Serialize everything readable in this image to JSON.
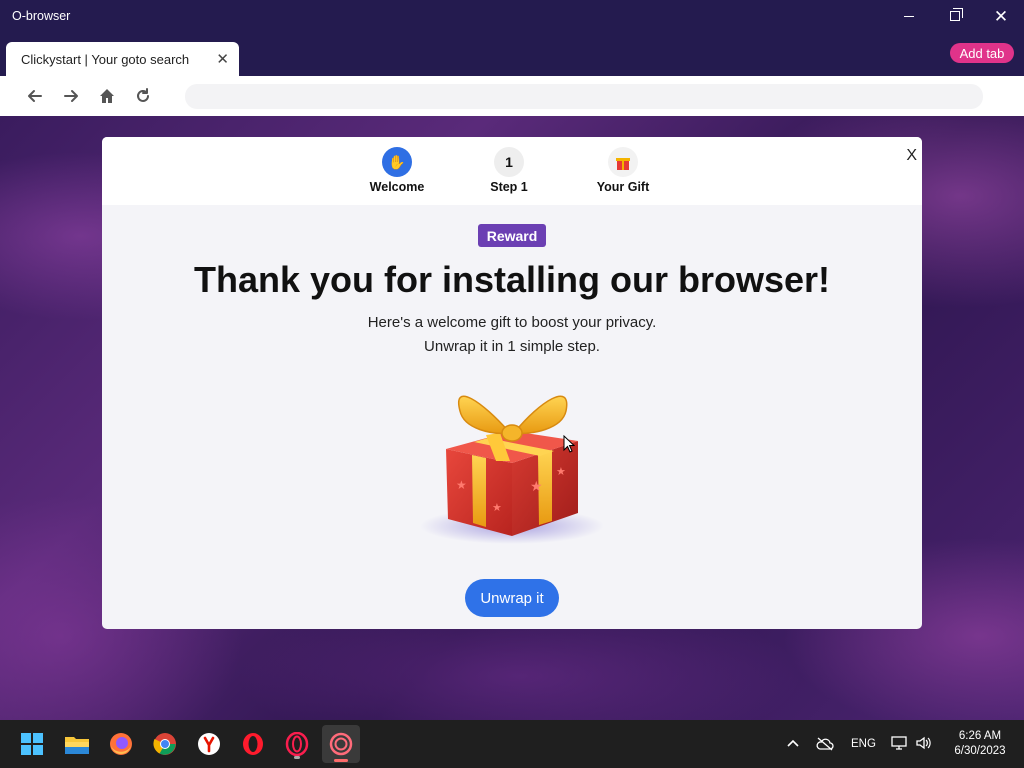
{
  "window": {
    "title": "O-browser"
  },
  "tabs": [
    {
      "label": "Clickystart | Your goto search",
      "close": "✕"
    }
  ],
  "add_tab_label": "Add tab",
  "address_bar": {
    "value": "",
    "placeholder": ""
  },
  "modal": {
    "close": "X",
    "steps": [
      {
        "label": "Welcome",
        "icon": "waving-hand-icon"
      },
      {
        "label": "Step 1",
        "number": "1"
      },
      {
        "label": "Your Gift",
        "icon": "gift-icon"
      }
    ],
    "badge": "Reward",
    "headline": "Thank you for installing our browser!",
    "subtitle_line1": "Here's a welcome gift to boost your privacy.",
    "subtitle_line2": "Unwrap it in 1 simple step.",
    "cta": "Unwrap it"
  },
  "taskbar": {
    "apps": [
      "windows-start-icon",
      "file-explorer-icon",
      "firefox-icon",
      "chrome-icon",
      "yandex-icon",
      "opera-icon",
      "opera-gx-icon",
      "o-browser-icon"
    ],
    "tray": {
      "language": "ENG",
      "time": "6:26 AM",
      "date": "6/30/2023"
    }
  },
  "colors": {
    "accent": "#2f72e8",
    "badge": "#6b3fb3",
    "add_tab": "#e0338a",
    "titlebar": "#241b4f"
  }
}
